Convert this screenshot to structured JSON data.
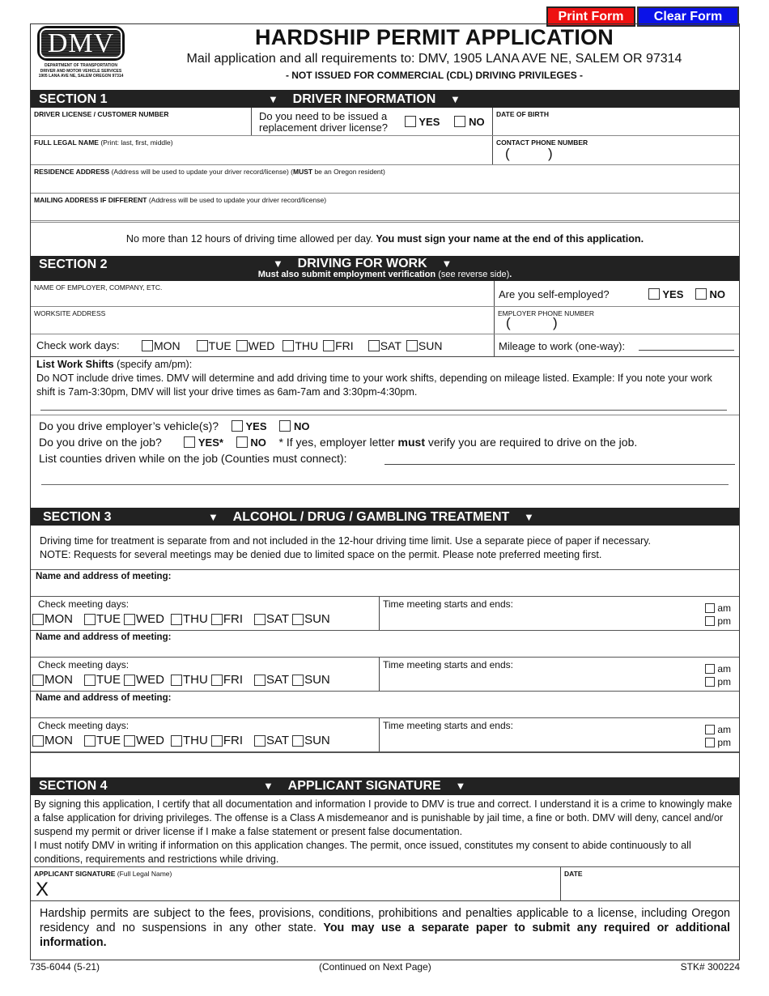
{
  "toolbar": {
    "print_label": "Print Form",
    "clear_label": "Clear Form",
    "print_color": "#ee1111",
    "clear_color": "#0b12e8"
  },
  "header": {
    "logo_text": "DMV",
    "logo_lines": [
      "DEPARTMENT OF TRANSPORTATION",
      "DRIVER AND MOTOR VEHICLE SERVICES",
      "1905 LANA AVE NE, SALEM OREGON 97314"
    ],
    "title": "HARDSHIP PERMIT APPLICATION",
    "mail_to": "Mail application and all requirements to:  DMV, 1905 LANA AVE NE, SALEM OR 97314",
    "not_cdl": "- NOT ISSUED FOR COMMERCIAL (CDL) DRIVING PRIVILEGES -"
  },
  "section1": {
    "number": "SECTION 1",
    "title": "DRIVER INFORMATION",
    "driver_license_label": "DRIVER LICENSE / CUSTOMER NUMBER",
    "replacement_q_line1": "Do you need to be issued a",
    "replacement_q_line2": "replacement driver license?",
    "yes": "YES",
    "no": "NO",
    "dob_label": "DATE OF BIRTH",
    "full_name_label": "FULL LEGAL NAME",
    "full_name_note": " (Print: last, first, middle)",
    "phone_label": "CONTACT PHONE NUMBER",
    "phone_paren_open": "(",
    "phone_paren_close": ")",
    "residence_label": "RESIDENCE ADDRESS",
    "residence_note1": " (Address will be used to update your driver record/license) (",
    "residence_must": "MUST",
    "residence_note2": " be an Oregon resident)",
    "mailing_label": "MAILING ADDRESS IF DIFFERENT",
    "mailing_note": " (Address will be used to update your driver record/license)"
  },
  "notice": {
    "normal": "No more than 12 hours of driving time allowed per day. ",
    "bold": "You must sign your name at the end of this application."
  },
  "section2": {
    "number": "SECTION 2",
    "title": "DRIVING FOR WORK",
    "sub_bold": "Must also submit employment verification",
    "sub_normal": " (see reverse side)",
    "sub_end": ".",
    "employer_label": "NAME OF EMPLOYER, COMPANY, ETC.",
    "self_employed_q": "Are you self-employed?",
    "yes": "YES",
    "no": "NO",
    "worksite_label": "WORKSITE ADDRESS",
    "employer_phone_label": "EMPLOYER PHONE NUMBER",
    "phone_paren_open": "(",
    "phone_paren_close": ")",
    "work_days_label": "Check work days:",
    "days": [
      "MON",
      "TUE",
      "WED",
      "THU",
      "FRI",
      "SAT",
      "SUN"
    ],
    "mileage_label": "Mileage to work (one-way):",
    "shifts_title": "List Work Shifts",
    "shifts_note": " (specify am/pm):",
    "shifts_text": "Do NOT include drive times. DMV will determine and add driving time to your work shifts, depending on mileage listed. Example: If you note your work shift is 7am-3:30pm, DMV will list your drive times as 6am-7am and 3:30pm-4:30pm.",
    "employer_vehicle_q": "Do you drive employer’s vehicle(s)?",
    "drive_on_job_q": "Do you drive on the job?",
    "yes_star": "YES*",
    "footnote_pre": "* If yes, employer letter ",
    "footnote_bold": "must",
    "footnote_post": " verify you are required to drive on the job.",
    "counties_label": "List counties driven while on the job (Counties must connect):"
  },
  "section3": {
    "number": "SECTION 3",
    "title": "ALCOHOL / DRUG / GAMBLING TREATMENT",
    "intro_line1": "Driving time for treatment is separate from and not included in the 12-hour driving time limit. Use a separate piece of paper if necessary.",
    "intro_line2": "NOTE: Requests for several meetings may be denied due to limited space on the permit. Please note preferred meeting first.",
    "meetings": [
      {
        "name_label": "Name and address of meeting:",
        "days_label": "Check meeting days:",
        "time_label": "Time meeting starts and ends:",
        "am": "am",
        "pm": "pm"
      },
      {
        "name_label": "Name and address of meeting:",
        "days_label": "Check meeting days:",
        "time_label": "Time meeting starts and ends:",
        "am": "am",
        "pm": "pm"
      },
      {
        "name_label": "Name and address of meeting:",
        "days_label": "Check meeting days:",
        "time_label": "Time meeting starts and ends:",
        "am": "am",
        "pm": "pm"
      }
    ],
    "days": [
      "MON",
      "TUE",
      "WED",
      "THU",
      "FRI",
      "SAT",
      "SUN"
    ]
  },
  "section4": {
    "number": "SECTION 4",
    "title": "APPLICANT SIGNATURE",
    "certify_p1": "By signing this application, I certify that all documentation and information I provide to DMV is true and correct. I understand it is a crime to knowingly make a false application for driving privileges. The offense is a Class A misdemeanor and is punishable by jail time, a fine or both. DMV will deny, cancel and/or suspend my permit or driver license if I make a false statement or present false documentation.",
    "certify_p2": "I must notify DMV in writing if information on this application changes. The permit, once issued, constitutes my consent to abide continuously to all conditions, requirements and restrictions while driving.",
    "signature_label": "APPLICANT SIGNATURE",
    "signature_note": " (Full Legal Name)",
    "signature_mark": "X",
    "date_label": "DATE",
    "closing_normal": "Hardship permits are subject to the fees, provisions, conditions, prohibitions and penalties applicable to a license, including Oregon residency and no suspensions in any other state. ",
    "closing_bold": "You may use a separate paper to submit any required or additional information."
  },
  "footer": {
    "form_number": "735-6044 (5-21)",
    "continued": "(Continued on Next Page)",
    "stock": "STK# 300224"
  }
}
